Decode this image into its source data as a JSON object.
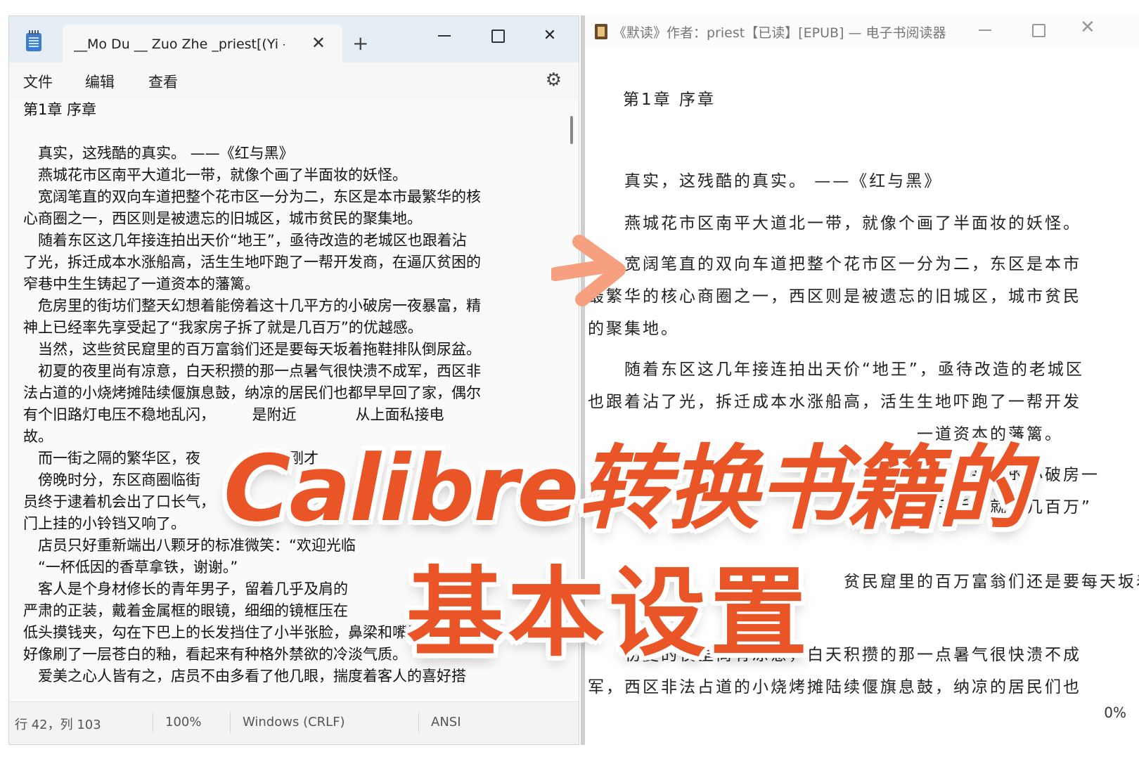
{
  "notepad": {
    "tab_title": "__Mo Du __ Zuo Zhe _priest[(Yi - \\",
    "tab_close_glyph": "✕",
    "new_tab_glyph": "+",
    "window_close_glyph": "✕",
    "menu": {
      "file": "文件",
      "edit": "编辑",
      "view": "查看"
    },
    "settings_glyph": "⚙",
    "lines": [
      "第1章 序章",
      "",
      "　真实，这残酷的真实。 ——《红与黑》",
      "　燕城花市区南平大道北一带，就像个画了半面妆的妖怪。",
      "　宽阔笔直的双向车道把整个花市区一分为二，东区是本市最繁华的核",
      "心商圈之一，西区则是被遗忘的旧城区，城市贫民的聚集地。",
      "　随着东区这几年接连拍出天价“地王”，亟待改造的老城区也跟着沾",
      "了光，拆迁成本水涨船高，活生生地吓跑了一帮开发商，在逼仄贫困的",
      "窄巷中生生铸起了一道资本的藩篱。",
      "　危房里的街坊们整天幻想着能傍着这十几平方的小破房一夜暴富，精",
      "神上已经率先享受起了“我家房子拆了就是几百万”的优越感。",
      "　当然，这些贫民窟里的百万富翁们还是要每天坂着拖鞋排队倒尿盆。",
      "　初夏的夜里尚有凉意，白天积攒的那一点暑气很快溃不成军，西区非",
      "法占道的小烧烤摊陆续偃旗息鼓，纳凉的居民们也都早早回了家，偶尔",
      "有个旧路灯电压不稳地乱闪，　　　是附近　　　　从上面私接电　　",
      "故。",
      "　而一街之隔的繁华区，夜　　　　　刚刚才",
      "　傍晚时分，东区商圈临街",
      "员终于逮着机会出了口长气，",
      "门上挂的小铃铛又响了。",
      "　店员只好重新端出八颗牙的标准微笑：“欢迎光临",
      "　“一杯低因的香草拿铁，谢谢。”",
      "　客人是个身材修长的青年男子，留着几乎及肩的",
      "严肃的正装，戴着金属框的眼镜，细细的镜框压在",
      "低头摸钱夹，勾在下巴上的长发挡住了小半张脸，鼻梁和嘴唇在灯光下",
      "好像刷了一层苍白的釉，看起来有种格外禁欲的冷淡气质。",
      "　爱美之心人皆有之，店员不由多看了他几眼，揣度着客人的喜好搭"
    ],
    "status": {
      "position": "行 42，列 103",
      "zoom": "100%",
      "line_ending": "Windows (CRLF)",
      "encoding": "ANSI"
    }
  },
  "reader": {
    "title": "《默读》作者：priest【已读】[EPUB] — 电子书阅读器",
    "close_glyph": "✕",
    "chapter_title": "第1章 序章",
    "lines": [
      "　　真实，这残酷的真实。 ——《红与黑》",
      "　　燕城花市区南平大道北一带，就像个画了半面妆的妖怪。",
      "　　宽阔笔直的双向车道把整个花市区一分为二，东区是本市",
      "最繁华的核心商圈之一，西区则是被遗忘的旧城区，城市贫民",
      "的聚集地。",
      "　　随着东区这几年接连拍出天价“地王”，亟待改造的老城区",
      "也跟着沾了光，拆迁成本水涨船高，活生生地吓跑了一帮开发",
      "　　　　　　　　　　　　　　　　　　一道资本的藩篱。",
      "　　　　　　　　　　　　　　　　　着这十几平方的小破房一",
      "　　　　　　　　　　　　　　　　我家房子拆了就是几百万”",
      "　　　　　　　　　　　　　　贫民窟里的百万富翁们还是要每天坂着拖鞋排",
      "　　初夏的夜里尚有凉意，白天积攒的那一点暑气很快溃不成",
      "军，西区非法占道的小烧烤摊陆续偃旗息鼓，纳凉的居民们也"
    ],
    "progress": "0%"
  },
  "overlay": {
    "line1": "Calibre转换书籍的",
    "line2": "基本设置"
  },
  "colors": {
    "accent": "#ea5528",
    "arrow": "#f7a07f",
    "notepad_titlebar": "#e6eef5"
  }
}
